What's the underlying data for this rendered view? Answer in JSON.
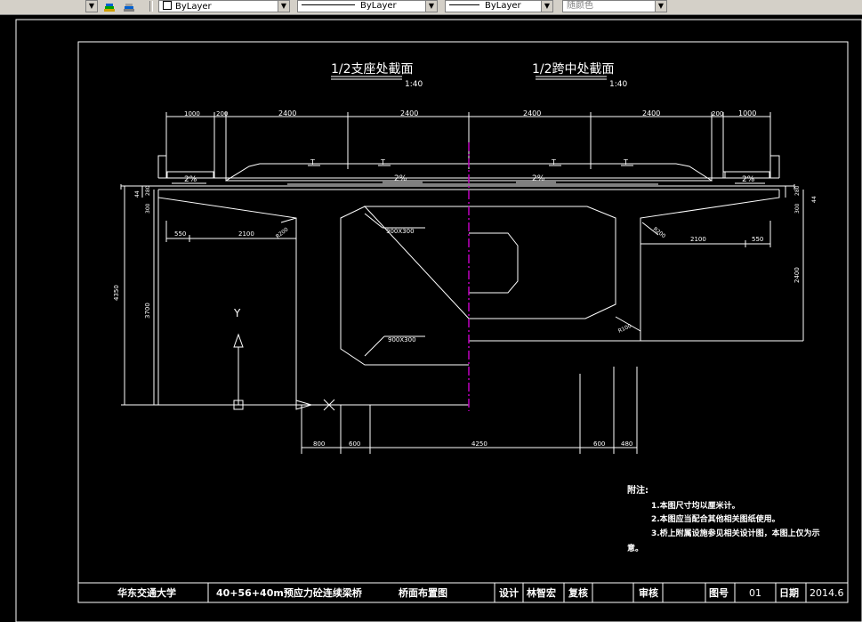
{
  "toolbar": {
    "color_control": "ByLayer",
    "linetype_control": "ByLayer",
    "lineweight_control": "ByLayer",
    "plotstyle_control": "随颜色"
  },
  "drawing": {
    "section_left_title": "1/2支座处截面",
    "section_right_title": "1/2跨中处截面",
    "scale_left": "1:40",
    "scale_right": "1:40",
    "top_dims": [
      "1000",
      "200",
      "2400",
      "2400",
      "2400",
      "2400",
      "200",
      "1000"
    ],
    "slope_labels": [
      "2%",
      "2%",
      "2%",
      "2%"
    ],
    "t_marks": [
      "T",
      "T",
      "T",
      "T"
    ],
    "left_dims": {
      "d44": "44",
      "d280": "280",
      "d300": "300",
      "d550": "550",
      "d2100": "2100",
      "d4350": "4350",
      "d3700": "3700",
      "d200": "R200"
    },
    "right_dims": {
      "d44": "44",
      "d280": "280",
      "d300": "300",
      "d550": "550",
      "d2100": "2100",
      "d2400": "2400",
      "d200": "R200"
    },
    "chamfer_top": "900X300",
    "chamfer_bottom": "900X300",
    "fillet": "R100",
    "bottom_dims": [
      "800",
      "600",
      "4250",
      "600",
      "480"
    ],
    "notes_title": "附注:",
    "notes": [
      "1.本图尺寸均以厘米计。",
      "2.本图应当配合其他相关图纸使用。",
      "3.桥上附属设施参见相关设计图，本图上仅为示",
      "意。"
    ],
    "ucs_y": "Y",
    "title_block": {
      "school": "华东交通大学",
      "project": "40+56+40m预应力砼连续梁桥",
      "drawing_name": "桥面布置图",
      "design_label": "设计",
      "designer": "林智宏",
      "check_label": "复核",
      "review_label": "审核",
      "drawing_no_label": "图号",
      "drawing_no": "01",
      "date_label": "日期",
      "date": "2014.6"
    }
  },
  "colors": {
    "background": "#000000",
    "line": "#ffffff",
    "centerline": "#c000c0",
    "toolbar": "#d4d0c8"
  }
}
